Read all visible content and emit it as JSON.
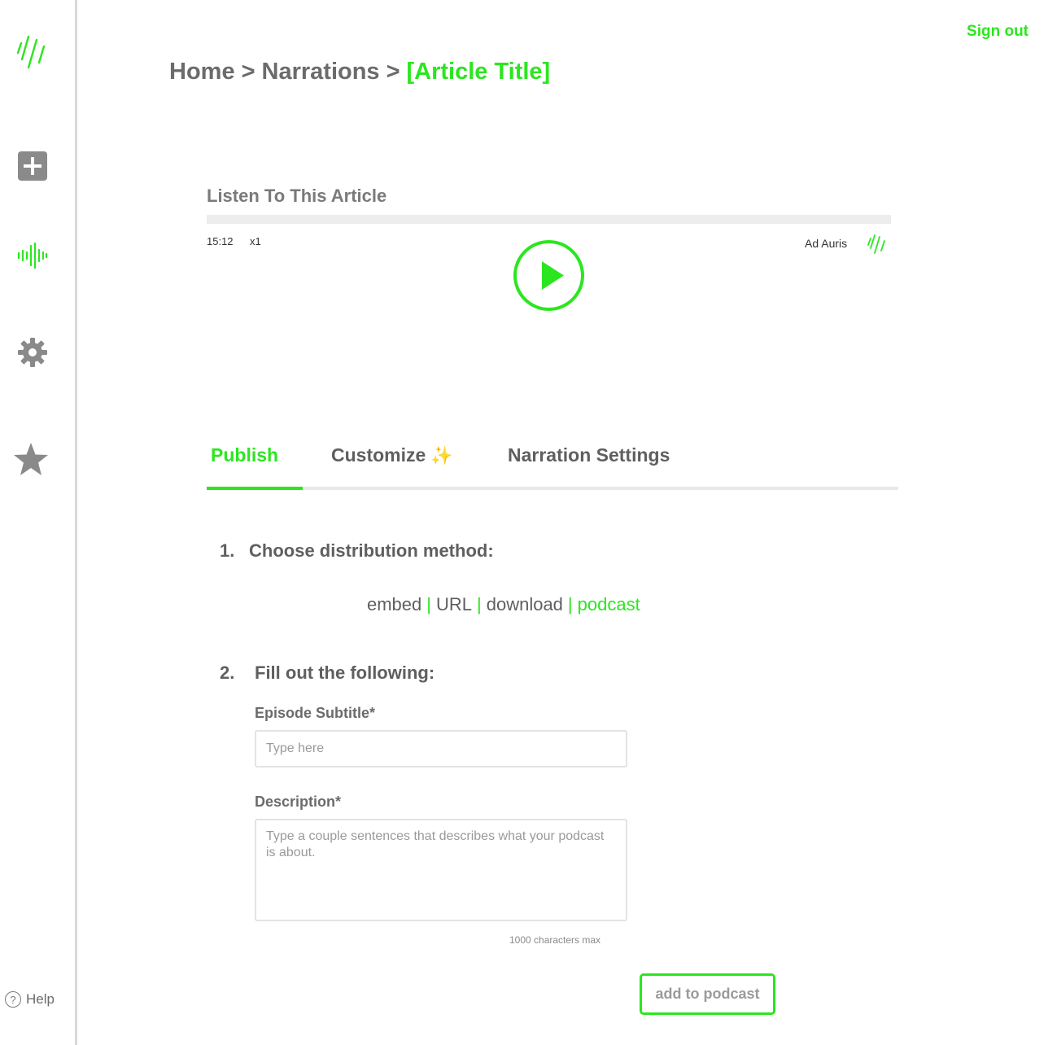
{
  "sidebar": {
    "help_label": "Help",
    "help_glyph": "?",
    "icons": [
      "logo-icon",
      "add-icon",
      "waveform-icon",
      "gear-icon",
      "star-icon"
    ]
  },
  "header": {
    "sign_out": "Sign out",
    "breadcrumb": {
      "home": "Home",
      "narrations": "Narrations",
      "current": "[Article Title]",
      "separator": ">"
    }
  },
  "player": {
    "title": "Listen To This Article",
    "time": "15:12",
    "speed": "x1",
    "brand": "Ad Auris",
    "progress": 0
  },
  "tabs": [
    {
      "label": "Publish",
      "active": true
    },
    {
      "label": "Customize",
      "active": false
    },
    {
      "label": "Narration Settings",
      "active": false
    }
  ],
  "tab_sparkle": "✨",
  "steps": {
    "step1": {
      "number": "1.",
      "title": "Choose distribution method:"
    },
    "distribution": {
      "options": [
        "embed",
        "URL",
        "download",
        "podcast"
      ],
      "separator": "|",
      "selected": "podcast"
    },
    "step2": {
      "number": "2.",
      "title": "Fill out the following:"
    }
  },
  "form": {
    "subtitle_label": "Episode Subtitle*",
    "subtitle_placeholder": "Type here",
    "description_label": "Description*",
    "description_placeholder": "Type a couple sentences that describes what your podcast is about.",
    "char_limit": "1000 characters max",
    "submit_label": "add to podcast"
  },
  "colors": {
    "accent": "#2be61f",
    "text": "#5f5f5f",
    "icon_gray": "#8a8a8a"
  }
}
